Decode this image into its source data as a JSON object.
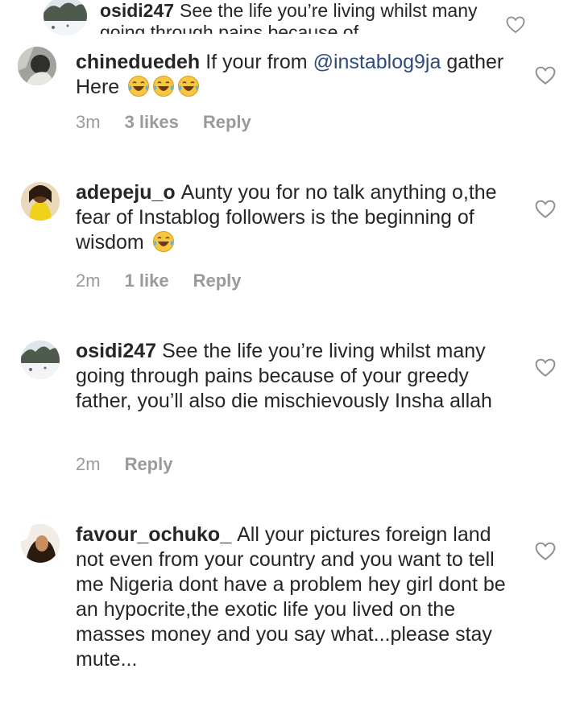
{
  "comments": [
    {
      "username": "osidi247",
      "text": "See the life you’re living whilst many going through pains because of",
      "avatar_icon": "snow-landscape-avatar-icon"
    },
    {
      "username": "chineduedeh",
      "text_before": "If your from",
      "mention": "@instablog9ja",
      "text_after": "gather Here",
      "emoji_icon": "laughing-tears-emoji-icon",
      "time": "3m",
      "likes": "3 likes",
      "reply": "Reply",
      "avatar_icon": "profile-avatar-icon"
    },
    {
      "username": "adepeju_o",
      "text": "Aunty you for no talk anything o,the fear of Instablog followers is the beginning of wisdom",
      "emoji_icon": "laughing-tears-emoji-icon",
      "time": "2m",
      "likes": "1 like",
      "reply": "Reply",
      "avatar_icon": "profile-avatar-icon"
    },
    {
      "username": "osidi247",
      "text": "See the life you’re living whilst many going through pains because of your greedy father, you’ll also die mischievously Insha allah",
      "time": "2m",
      "reply": "Reply",
      "avatar_icon": "snow-landscape-avatar-icon"
    },
    {
      "username": "favour_ochuko_",
      "text": "All your pictures foreign land not even from your country and you want to tell me Nigeria dont have a problem hey girl dont be an hypocrite,the exotic life you lived on the masses money and you say what...please stay mute...",
      "avatar_icon": "profile-avatar-icon"
    }
  ],
  "colors": {
    "text": "#262626",
    "meta": "#9a9a9a",
    "mention": "#2f4b7d",
    "heart_stroke": "#8e8e8e"
  },
  "icons": {
    "like": "heart-outline-icon"
  }
}
